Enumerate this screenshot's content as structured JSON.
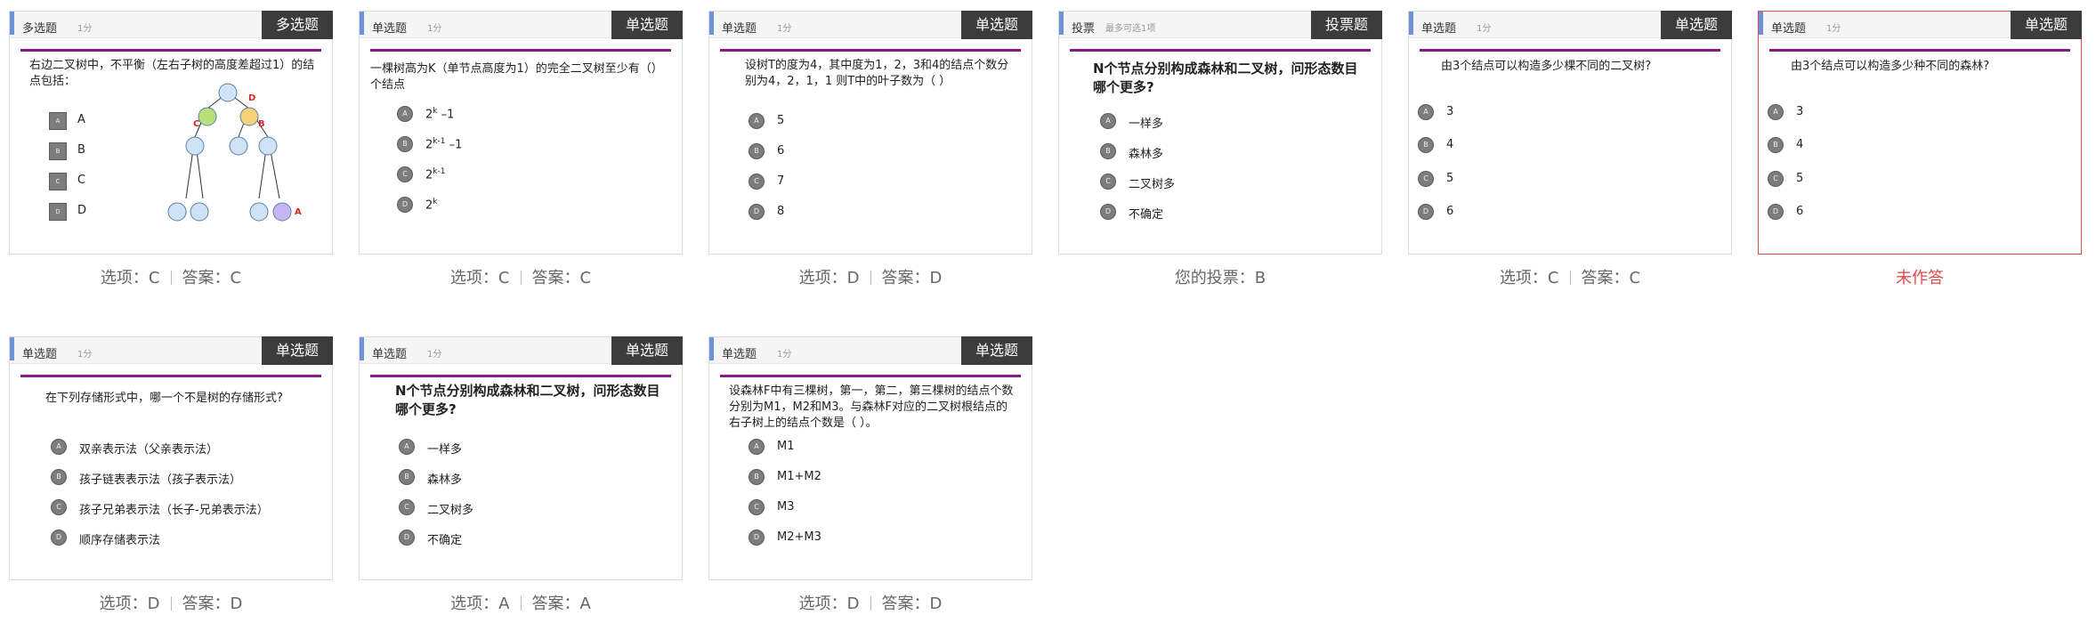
{
  "cards": [
    {
      "type_label": "多选题",
      "score": "1分",
      "tag": "多选题",
      "question": "右边二叉树中，不平衡（左右子树的高度差超过1）的结点包括：",
      "options": [
        {
          "letter": "A",
          "text": "A"
        },
        {
          "letter": "B",
          "text": "B"
        },
        {
          "letter": "C",
          "text": "C"
        },
        {
          "letter": "D",
          "text": "D"
        }
      ],
      "tree_labels": {
        "d": "D",
        "c": "C",
        "b": "B",
        "a": "A"
      },
      "result": {
        "choice": "选项：C",
        "answer": "答案：C"
      }
    },
    {
      "type_label": "单选题",
      "score": "1分",
      "tag": "单选题",
      "question": "一棵树高为K（单节点高度为1）的完全二叉树至少有（）个结点",
      "options": [
        {
          "letter": "A",
          "base": "2",
          "sup": "k",
          "suffix": " –1"
        },
        {
          "letter": "B",
          "base": "2",
          "sup": "k-1",
          "suffix": " –1"
        },
        {
          "letter": "C",
          "base": "2",
          "sup": "k-1",
          "suffix": ""
        },
        {
          "letter": "D",
          "base": "2",
          "sup": "k",
          "suffix": ""
        }
      ],
      "result": {
        "choice": "选项：C",
        "answer": "答案：C"
      }
    },
    {
      "type_label": "单选题",
      "score": "1分",
      "tag": "单选题",
      "question": "设树T的度为4，其中度为1，2，3和4的结点个数分别为4，2，1，1 则T中的叶子数为（ ）",
      "options": [
        {
          "letter": "A",
          "text": "5"
        },
        {
          "letter": "B",
          "text": "6"
        },
        {
          "letter": "C",
          "text": "7"
        },
        {
          "letter": "D",
          "text": "8"
        }
      ],
      "result": {
        "choice": "选项：D",
        "answer": "答案：D"
      }
    },
    {
      "type_label": "投票",
      "score": "最多可选1项",
      "tag": "投票题",
      "question": "N个节点分别构成森林和二叉树，问形态数目哪个更多?",
      "options": [
        {
          "letter": "A",
          "text": "一样多"
        },
        {
          "letter": "B",
          "text": "森林多"
        },
        {
          "letter": "C",
          "text": "二叉树多"
        },
        {
          "letter": "D",
          "text": "不确定"
        }
      ],
      "result": {
        "text": "您的投票：B"
      }
    },
    {
      "type_label": "单选题",
      "score": "1分",
      "tag": "单选题",
      "question": "由3个结点可以构造多少棵不同的二叉树?",
      "options": [
        {
          "letter": "A",
          "text": "3"
        },
        {
          "letter": "B",
          "text": "4"
        },
        {
          "letter": "C",
          "text": "5"
        },
        {
          "letter": "D",
          "text": "6"
        }
      ],
      "result": {
        "choice": "选项：C",
        "answer": "答案：C"
      }
    },
    {
      "type_label": "单选题",
      "score": "1分",
      "tag": "单选题",
      "question": "由3个结点可以构造多少种不同的森林?",
      "options": [
        {
          "letter": "A",
          "text": "3"
        },
        {
          "letter": "B",
          "text": "4"
        },
        {
          "letter": "C",
          "text": "5"
        },
        {
          "letter": "D",
          "text": "6"
        }
      ],
      "result": {
        "text": "未作答"
      }
    },
    {
      "type_label": "单选题",
      "score": "1分",
      "tag": "单选题",
      "question": "在下列存储形式中，哪一个不是树的存储形式?",
      "options": [
        {
          "letter": "A",
          "text": "双亲表示法（父亲表示法）"
        },
        {
          "letter": "B",
          "text": "孩子链表表示法（孩子表示法）"
        },
        {
          "letter": "C",
          "text": "孩子兄弟表示法（长子-兄弟表示法）"
        },
        {
          "letter": "D",
          "text": "顺序存储表示法"
        }
      ],
      "result": {
        "choice": "选项：D",
        "answer": "答案：D"
      }
    },
    {
      "type_label": "单选题",
      "score": "1分",
      "tag": "单选题",
      "question": "N个节点分别构成森林和二叉树，问形态数目哪个更多?",
      "options": [
        {
          "letter": "A",
          "text": "一样多"
        },
        {
          "letter": "B",
          "text": "森林多"
        },
        {
          "letter": "C",
          "text": "二叉树多"
        },
        {
          "letter": "D",
          "text": "不确定"
        }
      ],
      "result": {
        "choice": "选项：A",
        "answer": "答案：A"
      }
    },
    {
      "type_label": "单选题",
      "score": "1分",
      "tag": "单选题",
      "question": "设森林F中有三棵树，第一，第二，第三棵树的结点个数分别为M1，M2和M3。与森林F对应的二叉树根结点的右子树上的结点个数是（ ）。",
      "options": [
        {
          "letter": "A",
          "text": "M1"
        },
        {
          "letter": "B",
          "text": "M1+M2"
        },
        {
          "letter": "C",
          "text": "M3"
        },
        {
          "letter": "D",
          "text": "M2+M3"
        }
      ],
      "result": {
        "choice": "选项：D",
        "answer": "答案：D"
      }
    }
  ]
}
